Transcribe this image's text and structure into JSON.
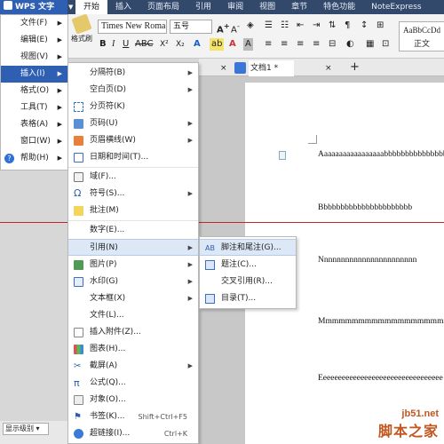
{
  "app": {
    "title": "WPS 文字"
  },
  "menubar": {
    "tabs": [
      "开始",
      "插入",
      "页面布局",
      "引用",
      "审阅",
      "视图",
      "章节",
      "特色功能",
      "NoteExpress"
    ]
  },
  "ribbon": {
    "format_painter_label": "格式刷",
    "font_name": "Times New Roma",
    "font_size": "五号",
    "style_preview": "AaBbCcDd",
    "style_name": "正文"
  },
  "left_menu": {
    "items": [
      {
        "label": "文件(F)"
      },
      {
        "label": "编辑(E)"
      },
      {
        "label": "视图(V)"
      },
      {
        "label": "插入(I)"
      },
      {
        "label": "格式(O)"
      },
      {
        "label": "工具(T)"
      },
      {
        "label": "表格(A)"
      },
      {
        "label": "窗口(W)"
      },
      {
        "label": "帮助(H)"
      }
    ]
  },
  "insert_menu": {
    "items": [
      {
        "label": "分隔符(B)",
        "submenu": true
      },
      {
        "label": "空白页(D)",
        "submenu": true
      },
      {
        "label": "分页符(K)"
      },
      {
        "label": "页码(U)",
        "submenu": true
      },
      {
        "label": "页眉横线(W)",
        "submenu": true
      },
      {
        "label": "日期和时间(T)..."
      },
      {
        "label": "域(F)..."
      },
      {
        "label": "符号(S)...",
        "submenu": true
      },
      {
        "label": "批注(M)"
      },
      {
        "label": "数字(E)..."
      },
      {
        "label": "引用(N)",
        "submenu": true
      },
      {
        "label": "图片(P)",
        "submenu": true
      },
      {
        "label": "水印(G)",
        "submenu": true
      },
      {
        "label": "文本框(X)",
        "submenu": true
      },
      {
        "label": "文件(L)..."
      },
      {
        "label": "插入附件(Z)..."
      },
      {
        "label": "图表(H)..."
      },
      {
        "label": "截屏(A)",
        "submenu": true
      },
      {
        "label": "公式(Q)..."
      },
      {
        "label": "对象(O)..."
      },
      {
        "label": "书签(K)...",
        "shortcut": "Shift+Ctrl+F5"
      },
      {
        "label": "超链接(I)...",
        "shortcut": "Ctrl+K"
      }
    ]
  },
  "reference_submenu": {
    "items": [
      {
        "label": "脚注和尾注(G)..."
      },
      {
        "label": "题注(C)..."
      },
      {
        "label": "交叉引用(R)..."
      },
      {
        "label": "目录(T)..."
      }
    ]
  },
  "document": {
    "tab_label": "文档1 *",
    "lines": [
      "Aaaaaaaaaaaaaaaaabbbbbbbbbbbbbbbbbb",
      "Bbbbbbbbbbbbbbbbbbbbbb",
      "Nnnnnnnnnnnnnnnnnnnnnnn",
      "Mmmmmmmmmmmmmmmmmmmmmmmmm",
      "Eeeeeeeeeeeeeeeeeeeeeeeeeeeeeeeee"
    ]
  },
  "statusbar": {
    "outline_level": "显示级别"
  },
  "watermark": {
    "line1": "jb51.net",
    "line2": "脚本之家"
  },
  "colors": {
    "accent": "#2f5fb3",
    "menu_highlight": "#dde8f7",
    "separator_line": "#c0262c"
  }
}
